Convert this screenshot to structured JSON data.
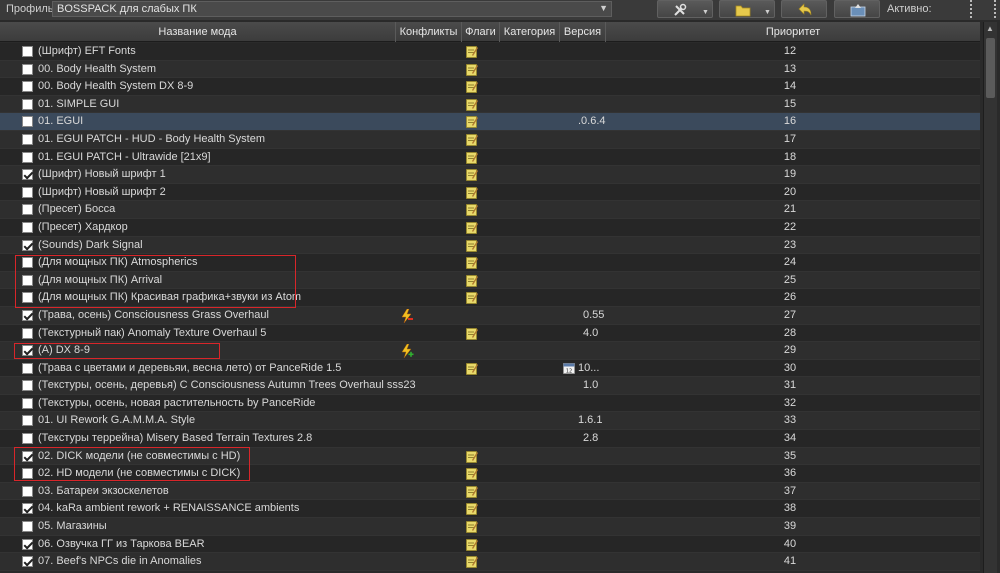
{
  "toolbar": {
    "profile_label": "Профиль",
    "profile_value": "BOSSPACK для слабых ПК",
    "active_label": "Активно:",
    "icons": [
      "tools-icon",
      "folder-icon",
      "undo-icon",
      "backup-icon"
    ]
  },
  "columns": {
    "name": "Название мода",
    "conflicts": "Конфликты",
    "flags": "Флаги",
    "category": "Категория",
    "version": "Версия",
    "priority": "Приоритет"
  },
  "colors": {
    "background": "#262626",
    "row_alt": "#2e2e2e",
    "selected_row": "#3b4a5c",
    "annotation_red": "#d8262a",
    "note_icon": "#e8d96a"
  },
  "mods": [
    {
      "checked": false,
      "name": "(Шрифт) EFT Fonts",
      "note": true,
      "version": "",
      "priority": "12"
    },
    {
      "checked": false,
      "name": "00. Body Health System",
      "note": true,
      "version": "",
      "priority": "13"
    },
    {
      "checked": false,
      "name": "00. Body Health System DX 8-9",
      "note": true,
      "version": "",
      "priority": "14"
    },
    {
      "checked": false,
      "name": "01. SIMPLE GUI",
      "note": true,
      "version": "",
      "priority": "15"
    },
    {
      "checked": false,
      "name": "01. EGUI",
      "note": true,
      "version": ".0.6.4",
      "priority": "16",
      "selected": true
    },
    {
      "checked": false,
      "name": "01. EGUI PATCH - HUD - Body Health System",
      "note": true,
      "version": "",
      "priority": "17"
    },
    {
      "checked": false,
      "name": "01. EGUI PATCH - Ultrawide [21x9]",
      "note": true,
      "version": "",
      "priority": "18"
    },
    {
      "checked": true,
      "name": "(Шрифт) Новый шрифт 1",
      "note": true,
      "version": "",
      "priority": "19"
    },
    {
      "checked": false,
      "name": "(Шрифт) Новый шрифт 2",
      "note": true,
      "version": "",
      "priority": "20"
    },
    {
      "checked": false,
      "name": "(Пресет) Босса",
      "note": true,
      "version": "",
      "priority": "21"
    },
    {
      "checked": false,
      "name": "(Пресет) Хардкор",
      "note": true,
      "version": "",
      "priority": "22"
    },
    {
      "checked": true,
      "name": "(Sounds) Dark Signal",
      "note": true,
      "version": "",
      "priority": "23"
    },
    {
      "checked": false,
      "name": "(Для мощных ПК) Atmospherics",
      "note": true,
      "version": "",
      "priority": "24"
    },
    {
      "checked": false,
      "name": "(Для мощных ПК) Arrival",
      "note": true,
      "version": "",
      "priority": "25"
    },
    {
      "checked": false,
      "name": "(Для мощных ПК) Красивая графика+звуки из Atom",
      "note": true,
      "version": "",
      "priority": "26"
    },
    {
      "checked": true,
      "name": "(Трава, осень) Consciousness Grass Overhaul",
      "conflict": "minus",
      "note": false,
      "version": "0.55",
      "priority": "27"
    },
    {
      "checked": false,
      "name": "(Текстурный пак) Anomaly Texture Overhaul 5",
      "note": true,
      "version": "4.0",
      "priority": "28"
    },
    {
      "checked": true,
      "name": "(A) DX 8-9",
      "conflict": "plus",
      "note": false,
      "version": "",
      "priority": "29"
    },
    {
      "checked": false,
      "name": "(Трава с цветами и деревьяи, весна лето) от PanceRide 1.5",
      "note": true,
      "calendar": true,
      "version": "10...",
      "priority": "30"
    },
    {
      "checked": false,
      "name": "(Текстуры, осень, деревья) C Consciousness Autumn Trees Overhaul sss23",
      "note": false,
      "version": "1.0",
      "priority": "31"
    },
    {
      "checked": false,
      "name": "(Текстуры, осень, новая растительность by PanceRide",
      "note": false,
      "version": "",
      "priority": "32"
    },
    {
      "checked": false,
      "name": "01. UI Rework G.A.M.M.A. Style",
      "note": false,
      "version": "1.6.1",
      "priority": "33"
    },
    {
      "checked": false,
      "name": "(Текстуры террейна) Misery Based Terrain Textures 2.8",
      "note": false,
      "version": "2.8",
      "priority": "34"
    },
    {
      "checked": true,
      "name": "02. DICK модели (не совместимы с HD)",
      "note": true,
      "version": "",
      "priority": "35"
    },
    {
      "checked": false,
      "name": "02. HD модели (не совместимы с DICK)",
      "note": true,
      "version": "",
      "priority": "36"
    },
    {
      "checked": false,
      "name": "03. Батареи экзоскелетов",
      "note": true,
      "version": "",
      "priority": "37"
    },
    {
      "checked": true,
      "name": "04. kaRa ambient rework + RENAISSANCE ambients",
      "note": true,
      "version": "",
      "priority": "38"
    },
    {
      "checked": false,
      "name": "05. Магазины",
      "note": true,
      "version": "",
      "priority": "39"
    },
    {
      "checked": true,
      "name": "06. Озвучка ГГ из Таркова BEAR",
      "note": true,
      "version": "",
      "priority": "40"
    },
    {
      "checked": true,
      "name": "07. Beef's NPCs die in Anomalies",
      "note": true,
      "version": "",
      "priority": "41"
    }
  ]
}
